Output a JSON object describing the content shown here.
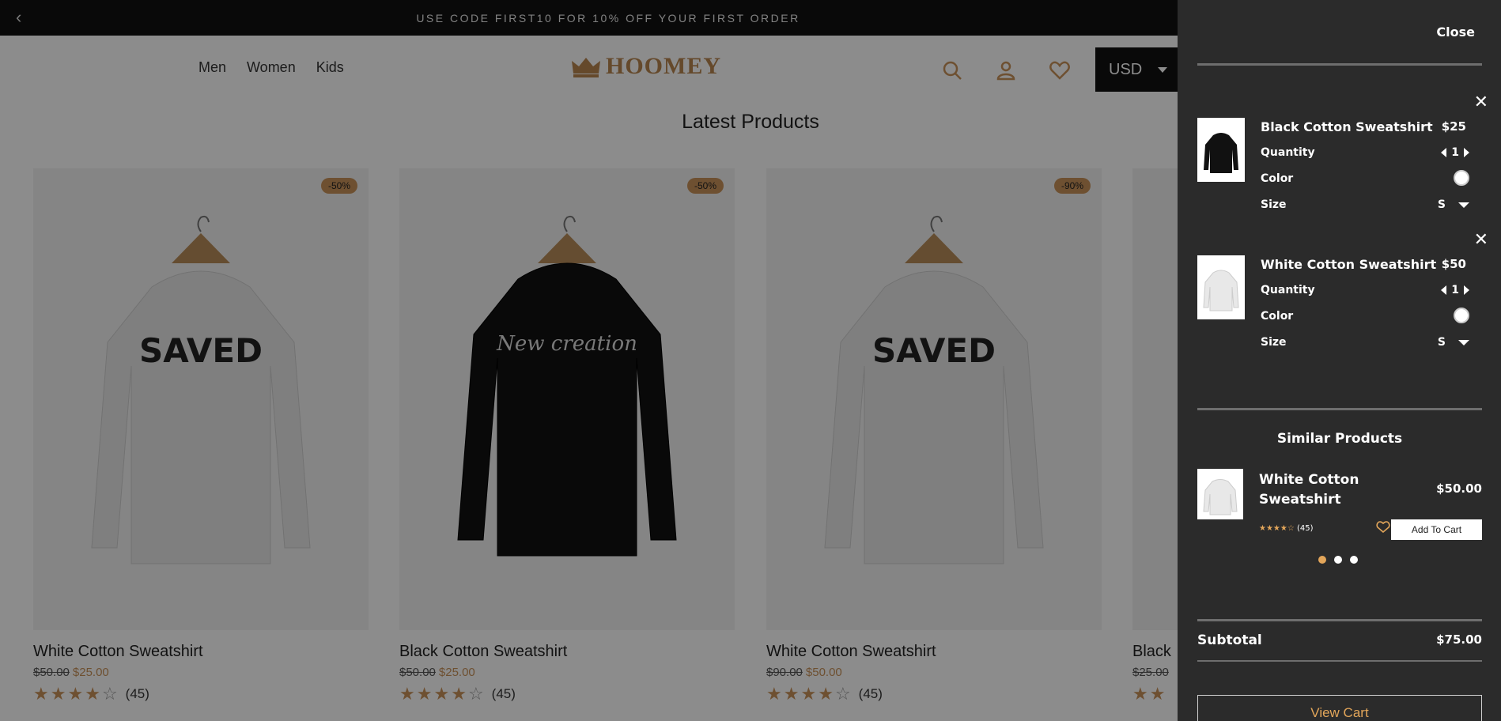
{
  "promo": {
    "text": "USE CODE FIRST10 FOR 10% OFF YOUR FIRST ORDER"
  },
  "nav": {
    "links": [
      "Men",
      "Women",
      "Kids"
    ],
    "brand": "HOOMEY",
    "currency": "USD"
  },
  "section": {
    "title": "Latest Products"
  },
  "products": [
    {
      "name": "White Cotton Sweatshirt",
      "old_price": "$50.00",
      "new_price": "$25.00",
      "badge": "-50%",
      "rating": 4,
      "reviews": "(45)",
      "color": "white"
    },
    {
      "name": "Black Cotton Sweatshirt",
      "old_price": "$50.00",
      "new_price": "$25.00",
      "badge": "-50%",
      "rating": 4,
      "reviews": "(45)",
      "color": "black"
    },
    {
      "name": "White Cotton Sweatshirt",
      "old_price": "$90.00",
      "new_price": "$50.00",
      "badge": "-90%",
      "rating": 4,
      "reviews": "(45)",
      "color": "white"
    },
    {
      "name": "Black",
      "old_price": "$25.00",
      "new_price": "",
      "badge": "",
      "rating": 4,
      "reviews": "",
      "color": "black"
    }
  ],
  "drawer": {
    "close_label": "Close",
    "items": [
      {
        "title": "Black Cotton Sweatshirt",
        "price": "$25",
        "quantity_label": "Quantity",
        "quantity": "1",
        "color_label": "Color",
        "size_label": "Size",
        "size": "S",
        "thumb_color": "black"
      },
      {
        "title": "White Cotton Sweatshirt",
        "price": "$50",
        "quantity_label": "Quantity",
        "quantity": "1",
        "color_label": "Color",
        "size_label": "Size",
        "size": "S",
        "thumb_color": "white"
      }
    ],
    "similar_title": "Similar Products",
    "similar": {
      "title": "White Cotton Sweatshirt",
      "price": "$50.00",
      "stars": "★★★★☆",
      "reviews": "(45)",
      "add_label": "Add To Cart"
    },
    "subtotal_label": "Subtotal",
    "subtotal": "$75.00",
    "view_cart_label": "View Cart"
  },
  "colors": {
    "accent": "#c9935a",
    "drawer_bg": "#2b2b2b",
    "promo_bg": "#111111"
  }
}
